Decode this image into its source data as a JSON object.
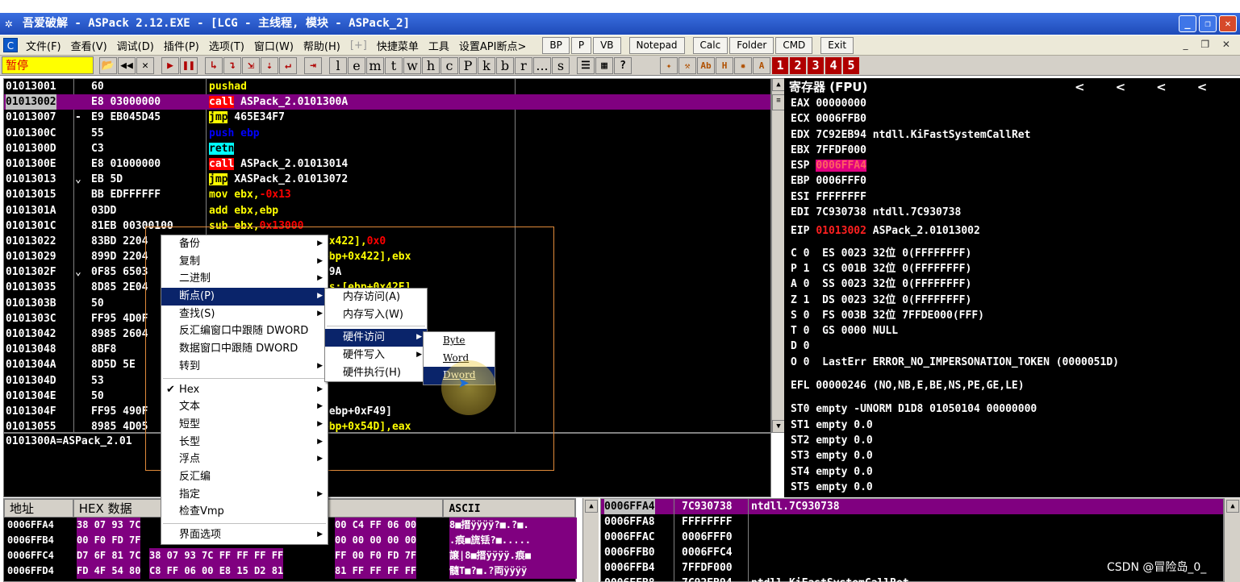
{
  "window": {
    "title": "吾爱破解 - ASPack 2.12.EXE - [LCG - 主线程, 模块 - ASPack_2]"
  },
  "menu": [
    "文件(F)",
    "查看(V)",
    "调试(D)",
    "插件(P)",
    "选项(T)",
    "窗口(W)",
    "帮助(H)",
    "[+]",
    "快捷菜单",
    "工具",
    "设置API断点>"
  ],
  "menu_buttons": [
    "BP",
    "P",
    "VB",
    "Notepad",
    "Calc",
    "Folder",
    "CMD",
    "Exit"
  ],
  "toolbar": {
    "status": "暂停",
    "letters": [
      "l",
      "e",
      "m",
      "t",
      "w",
      "h",
      "c",
      "P",
      "k",
      "b",
      "r",
      "...",
      "s"
    ],
    "numbers": [
      "1",
      "2",
      "3",
      "4",
      "5"
    ]
  },
  "disasm": [
    {
      "addr": "01013001",
      "mark": "",
      "hex": "60",
      "asm": [
        [
          "pushad",
          "kw-pushad"
        ]
      ]
    },
    {
      "addr": "01013002",
      "mark": "",
      "hex": "E8 03000000",
      "asm": [
        [
          "call",
          "kw-call"
        ],
        [
          " ASPack_2.0101300A",
          ""
        ]
      ],
      "selected": true
    },
    {
      "addr": "01013007",
      "mark": "-",
      "hex": "E9 EB045D45",
      "asm": [
        [
          "jmp",
          "kw-jmp"
        ],
        [
          " 465E34F7",
          ""
        ]
      ]
    },
    {
      "addr": "0101300C",
      "mark": "",
      "hex": "55",
      "asm": [
        [
          "push",
          "kw-push"
        ],
        [
          " ebp",
          "kw-push"
        ]
      ]
    },
    {
      "addr": "0101300D",
      "mark": "",
      "hex": "C3",
      "asm": [
        [
          "retn",
          "kw-retn"
        ]
      ]
    },
    {
      "addr": "0101300E",
      "mark": "",
      "hex": "E8 01000000",
      "asm": [
        [
          "call",
          "kw-call"
        ],
        [
          " ASPack_2.01013014",
          ""
        ]
      ]
    },
    {
      "addr": "01013013",
      "mark": "⌄",
      "hex": "EB 5D",
      "asm": [
        [
          "jmp",
          "kw-jmp"
        ],
        [
          " XASPack_2.01013072",
          ""
        ]
      ]
    },
    {
      "addr": "01013015",
      "mark": "",
      "hex": "BB EDFFFFFF",
      "asm": [
        [
          "mov ebx,",
          "kw-mov"
        ],
        [
          "-0x13",
          "neg"
        ]
      ]
    },
    {
      "addr": "0101301A",
      "mark": "",
      "hex": "03DD",
      "asm": [
        [
          "add ebx,ebp",
          "kw-add"
        ]
      ]
    },
    {
      "addr": "0101301C",
      "mark": "",
      "hex": "81EB 00300100",
      "asm": [
        [
          "sub ebx,",
          "kw-sub"
        ],
        [
          "0x13000",
          "neg"
        ]
      ]
    },
    {
      "addr": "01013022",
      "mark": "",
      "hex": "83BD 2204",
      "asm": [
        [
          "dword ptr ss:[ebp+0x422],",
          "kw-mov"
        ],
        [
          "0x0",
          "neg"
        ]
      ]
    },
    {
      "addr": "01013029",
      "mark": "",
      "hex": "899D 2204",
      "asm": [
        [
          "mov dword ptr ss:[ebp+0x422],ebx",
          "kw-mov"
        ]
      ]
    },
    {
      "addr": "0101302F",
      "mark": "⌄",
      "hex": "0F85 6503",
      "asm": [
        [
          "jnz ASPack_2.0101339A",
          ""
        ]
      ]
    },
    {
      "addr": "01013035",
      "mark": "",
      "hex": "8D85 2E04",
      "asm": [
        [
          "lea eax,dword ptr ss:[ebp+0x42E]",
          "kw-mov"
        ]
      ]
    },
    {
      "addr": "0101303B",
      "mark": "",
      "hex": "50",
      "asm": [
        [
          "push eax",
          "kw-push"
        ]
      ]
    },
    {
      "addr": "0101303C",
      "mark": "",
      "hex": "FF95 4D0F",
      "asm": [
        [
          "call dword ptr ss:[ebp+0xF4D]",
          ""
        ]
      ]
    },
    {
      "addr": "01013042",
      "mark": "",
      "hex": "8985 2604",
      "asm": [
        [
          "mov dword ptr ss:[ebp+0x426],eax",
          "kw-mov"
        ]
      ]
    },
    {
      "addr": "01013048",
      "mark": "",
      "hex": "8BF8",
      "asm": [
        [
          "mov edi,eax",
          "kw-mov"
        ]
      ]
    },
    {
      "addr": "0101304A",
      "mark": "",
      "hex": "8D5D 5E",
      "asm": [
        [
          "lea ebx,dword ptr ss:[ebp+0x5E]",
          "kw-mov"
        ]
      ]
    },
    {
      "addr": "0101304D",
      "mark": "",
      "hex": "53",
      "asm": [
        [
          "push ebx",
          "kw-push"
        ]
      ]
    },
    {
      "addr": "0101304E",
      "mark": "",
      "hex": "50",
      "asm": [
        [
          "push eax",
          "kw-push"
        ]
      ]
    },
    {
      "addr": "0101304F",
      "mark": "",
      "hex": "FF95 490F",
      "asm": [
        [
          "call dword ptr ss:[ebp+0xF49]",
          ""
        ]
      ]
    },
    {
      "addr": "01013055",
      "mark": "",
      "hex": "8985 4D05",
      "asm": [
        [
          "mov dword ptr ss:[ebp+0x54D],eax",
          "kw-mov"
        ]
      ]
    }
  ],
  "visible_right_asm": [
    ":[ebp+0x422],",
    ":[ebp+0x422],ebx",
    "01339A",
    "[ebp+0x42E]",
    ":[ebp+0xF49]",
    ":[ebp+0x54D],eax"
  ],
  "info_line": "0101300A=ASPack_2.01",
  "registers": {
    "header": "寄存器 (FPU)",
    "nav": [
      "<",
      "<",
      "<",
      "<"
    ],
    "lines": [
      [
        "EAX ",
        "00000000",
        ""
      ],
      [
        "ECX ",
        "0006FFB0",
        ""
      ],
      [
        "EDX ",
        "7C92EB94",
        " ntdll.KiFastSystemCallRet"
      ],
      [
        "EBX ",
        "7FFDF000",
        ""
      ],
      [
        "ESP ",
        "0006FFA4",
        ""
      ],
      [
        "EBP ",
        "0006FFF0",
        ""
      ],
      [
        "ESI ",
        "FFFFFFFF",
        ""
      ],
      [
        "EDI ",
        "7C930738",
        " ntdll.7C930738"
      ]
    ],
    "eip": [
      "EIP ",
      "01013002",
      " ASPack_2.01013002"
    ],
    "flags": [
      "C 0  ES 0023 32位 0(FFFFFFFF)",
      "P 1  CS 001B 32位 0(FFFFFFFF)",
      "A 0  SS 0023 32位 0(FFFFFFFF)",
      "Z 1  DS 0023 32位 0(FFFFFFFF)",
      "S 0  FS 003B 32位 7FFDE000(FFF)",
      "T 0  GS 0000 NULL",
      "D 0",
      "O 0  LastErr ERROR_NO_IMPERSONATION_TOKEN (0000051D)"
    ],
    "efl": "EFL 00000246 (NO,NB,E,BE,NS,PE,GE,LE)",
    "fpu": [
      "ST0 empty -UNORM D1D8 01050104 00000000",
      "ST1 empty 0.0",
      "ST2 empty 0.0",
      "ST3 empty 0.0",
      "ST4 empty 0.0",
      "ST5 empty 0.0"
    ]
  },
  "dump": {
    "headers": [
      "地址",
      "HEX 数据",
      "ASCII"
    ],
    "rows": [
      {
        "addr": "0006FFA4",
        "hex1": "38 07 93 7C",
        "hex2": "00 C4 FF 06 00",
        "ascii": "8■搢ÿÿÿÿ?■.?■."
      },
      {
        "addr": "0006FFB4",
        "hex1": "00 F0 FD 7F",
        "hex2": "00 00 00 00 00",
        "ascii": ".痕■旒铥?■....."
      },
      {
        "addr": "0006FFC4",
        "hex1": "D7 6F 81 7C",
        "hex2": "FF 00 F0 FD 7F",
        "ascii": "譲|8■搢ÿÿÿÿ.痕■"
      },
      {
        "addr": "0006FFD4",
        "hex1": "FD 4F 54 80",
        "hex2": "81 FF FF FF FF",
        "ascii": "髓T■?■.?両ÿÿÿÿ"
      }
    ],
    "mid_hex": [
      "38 07 93 7C FF FF FF FF",
      "C8 FF 06 00 E8 15 D2 81"
    ],
    "mid_hex_full_3": "38 07 93 7C FF FF FF FF",
    "mid_hex_full_4": "C8 FF 06 00 E8 15 D2 81"
  },
  "stack": {
    "rows": [
      {
        "addr": "0006FFA4",
        "val": "7C930738",
        "cmt": "ntdll.7C930738"
      },
      {
        "addr": "0006FFA8",
        "val": "FFFFFFFF",
        "cmt": ""
      },
      {
        "addr": "0006FFAC",
        "val": "0006FFF0",
        "cmt": ""
      },
      {
        "addr": "0006FFB0",
        "val": "0006FFC4",
        "cmt": ""
      },
      {
        "addr": "0006FFB4",
        "val": "7FFDF000",
        "cmt": ""
      },
      {
        "addr": "0006FFB8",
        "val": "7C92EB94",
        "cmt": "ntdll.KiFastSystemCallRet"
      }
    ]
  },
  "context_menu": {
    "items": [
      {
        "label": "备份",
        "arrow": true
      },
      {
        "label": "复制",
        "arrow": true
      },
      {
        "label": "二进制",
        "arrow": true
      },
      {
        "label": "断点(P)",
        "arrow": true,
        "selected": true
      },
      {
        "label": "查找(S)",
        "arrow": true
      },
      {
        "label": "反汇编窗口中跟随 DWORD",
        "arrow": false
      },
      {
        "label": "数据窗口中跟随 DWORD",
        "arrow": false
      },
      {
        "label": "转到",
        "arrow": true
      },
      {
        "sep": true
      },
      {
        "label": "Hex",
        "arrow": true,
        "check": true
      },
      {
        "label": "文本",
        "arrow": true
      },
      {
        "label": "短型",
        "arrow": true
      },
      {
        "label": "长型",
        "arrow": true
      },
      {
        "label": "浮点",
        "arrow": true
      },
      {
        "label": "反汇编",
        "arrow": false
      },
      {
        "label": "指定",
        "arrow": true
      },
      {
        "label": "检查Vmp",
        "arrow": false
      },
      {
        "sep": true
      },
      {
        "label": "界面选项",
        "arrow": true
      }
    ],
    "sub1": [
      {
        "label": "内存访问(A)"
      },
      {
        "label": "内存写入(W)"
      },
      {
        "sep": true
      },
      {
        "label": "硬件访问",
        "arrow": true,
        "selected": true
      },
      {
        "label": "硬件写入",
        "arrow": true
      },
      {
        "label": "硬件执行(H)"
      }
    ],
    "sub2": [
      {
        "label": "Byte"
      },
      {
        "label": "Word"
      },
      {
        "label": "Dword",
        "selected": true
      }
    ]
  },
  "watermark": "CSDN @冒险岛_0_"
}
